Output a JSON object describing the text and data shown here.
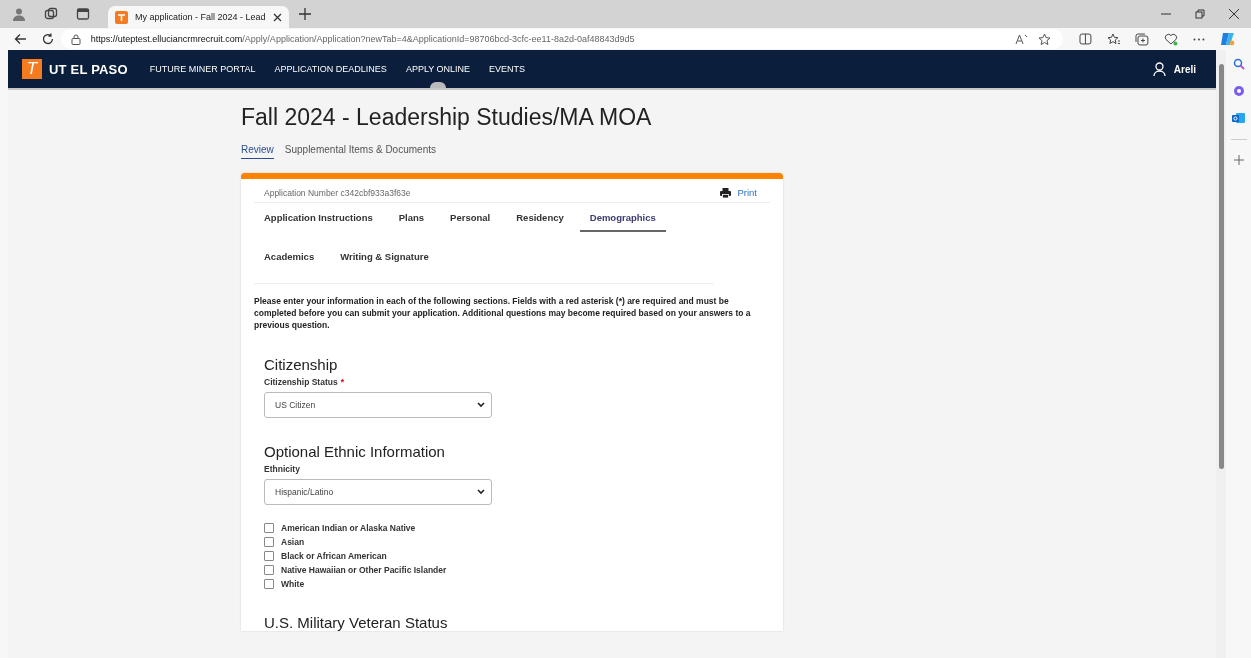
{
  "browser": {
    "tab_title": "My application - Fall 2024 - Lead",
    "url_host": "https://uteptest.elluciancrmrecruit.com",
    "url_path": "/Apply/Application/Application?newTab=4&ApplicationId=98706bcd-3cfc-ee11-8a2d-0af48843d9d5"
  },
  "site_nav": {
    "logo_letter": "T",
    "logo_text": "UT EL PASO",
    "links": [
      {
        "label": "FUTURE MINER PORTAL",
        "selected": false
      },
      {
        "label": "APPLICATION DEADLINES",
        "selected": false
      },
      {
        "label": "APPLY ONLINE",
        "selected": true
      },
      {
        "label": "EVENTS",
        "selected": false
      }
    ],
    "user": "Areli"
  },
  "page": {
    "title": "Fall 2024 - Leadership Studies/MA MOA",
    "tabs": [
      {
        "label": "Review",
        "selected": true
      },
      {
        "label": "Supplemental Items & Documents",
        "selected": false
      }
    ]
  },
  "application": {
    "number": "Application Number c342cbf933a3f63e",
    "print": "Print",
    "tabs": [
      {
        "label": "Application Instructions",
        "selected": false
      },
      {
        "label": "Plans",
        "selected": false
      },
      {
        "label": "Personal",
        "selected": false
      },
      {
        "label": "Residency",
        "selected": false
      },
      {
        "label": "Demographics",
        "selected": true
      },
      {
        "label": "Academics",
        "selected": false
      },
      {
        "label": "Writing & Signature",
        "selected": false
      }
    ],
    "intro": "Please enter your information in each of the following sections. Fields with a red asterisk (*) are required and must be completed before you can submit your application. Additional questions may become required based on your answers to a previous question.",
    "sections": [
      {
        "kind": "select",
        "heading": "Citizenship",
        "label": "Citizenship Status",
        "required_mark": "*",
        "value": "US Citizen"
      },
      {
        "kind": "select",
        "heading": "Optional Ethnic Information",
        "label": "Ethnicity",
        "value": "Hispanic/Latino",
        "checkboxes": [
          {
            "label": "American Indian or Alaska Native",
            "checked": false
          },
          {
            "label": "Asian",
            "checked": false
          },
          {
            "label": "Black or African American",
            "checked": false
          },
          {
            "label": "Native Hawaiian or Other Pacific Islander",
            "checked": false
          },
          {
            "label": "White",
            "checked": false
          }
        ]
      },
      {
        "kind": "heading",
        "heading": "U.S. Military Veteran Status"
      }
    ]
  }
}
